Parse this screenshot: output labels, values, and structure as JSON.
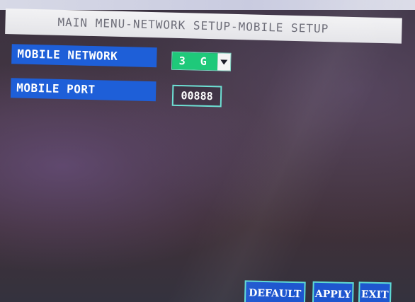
{
  "header": {
    "title": "MAIN MENU-NETWORK SETUP-MOBILE SETUP"
  },
  "settings": {
    "mobile_network": {
      "label": "MOBILE NETWORK",
      "value": "3 G"
    },
    "mobile_port": {
      "label": "MOBILE PORT",
      "value": "00888"
    }
  },
  "footer": {
    "default_label": "DEFAULT",
    "apply_label": "APPLY",
    "exit_label": "EXIT"
  },
  "colors": {
    "label_bg": "#1e5fd8",
    "select_bg": "#1fc97a",
    "field_border": "#6ee0d4",
    "title_bg": "#f2f2f4"
  },
  "icons": {
    "dropdown": "chevron-down-icon"
  }
}
